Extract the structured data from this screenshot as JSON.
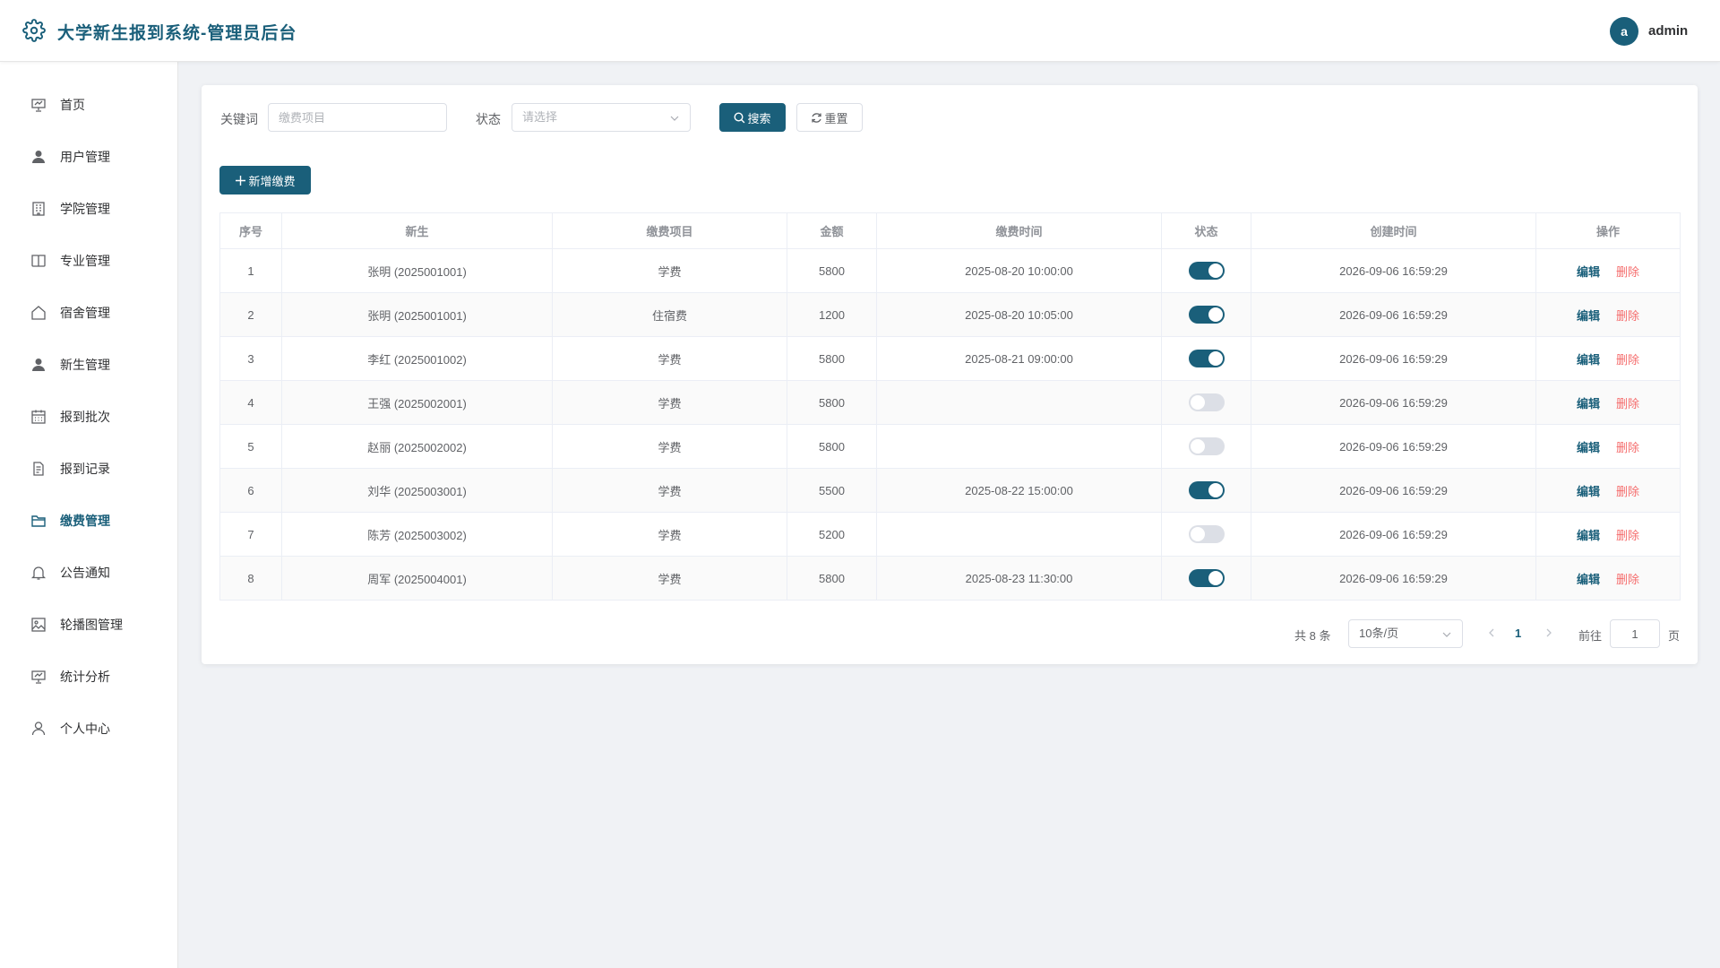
{
  "header": {
    "title": "大学新生报到系统-管理员后台",
    "avatar_letter": "a",
    "username": "admin"
  },
  "sidebar": {
    "items": [
      {
        "label": "首页",
        "icon": "presentation-icon"
      },
      {
        "label": "用户管理",
        "icon": "user-icon"
      },
      {
        "label": "学院管理",
        "icon": "building-icon"
      },
      {
        "label": "专业管理",
        "icon": "book-icon"
      },
      {
        "label": "宿舍管理",
        "icon": "home-icon"
      },
      {
        "label": "新生管理",
        "icon": "user-icon"
      },
      {
        "label": "报到批次",
        "icon": "calendar-icon"
      },
      {
        "label": "报到记录",
        "icon": "document-icon"
      },
      {
        "label": "缴费管理",
        "icon": "folder-icon",
        "active": true
      },
      {
        "label": "公告通知",
        "icon": "bell-icon"
      },
      {
        "label": "轮播图管理",
        "icon": "picture-icon"
      },
      {
        "label": "统计分析",
        "icon": "chart-icon"
      },
      {
        "label": "个人中心",
        "icon": "user-outline-icon"
      }
    ]
  },
  "filters": {
    "keyword_label": "关键词",
    "keyword_placeholder": "缴费项目",
    "status_label": "状态",
    "status_placeholder": "请选择",
    "search_label": "搜索",
    "reset_label": "重置"
  },
  "toolbar": {
    "add_label": "新增缴费"
  },
  "table": {
    "columns": [
      "序号",
      "新生",
      "缴费项目",
      "金额",
      "缴费时间",
      "状态",
      "创建时间",
      "操作"
    ],
    "edit_label": "编辑",
    "delete_label": "删除",
    "rows": [
      {
        "index": "1",
        "student": "张明 (2025001001)",
        "item": "学费",
        "amount": "5800",
        "pay_time": "2025-08-20 10:00:00",
        "paid": true,
        "created": "2026-09-06 16:59:29"
      },
      {
        "index": "2",
        "student": "张明 (2025001001)",
        "item": "住宿费",
        "amount": "1200",
        "pay_time": "2025-08-20 10:05:00",
        "paid": true,
        "created": "2026-09-06 16:59:29"
      },
      {
        "index": "3",
        "student": "李红 (2025001002)",
        "item": "学费",
        "amount": "5800",
        "pay_time": "2025-08-21 09:00:00",
        "paid": true,
        "created": "2026-09-06 16:59:29"
      },
      {
        "index": "4",
        "student": "王强 (2025002001)",
        "item": "学费",
        "amount": "5800",
        "pay_time": "",
        "paid": false,
        "created": "2026-09-06 16:59:29"
      },
      {
        "index": "5",
        "student": "赵丽 (2025002002)",
        "item": "学费",
        "amount": "5800",
        "pay_time": "",
        "paid": false,
        "created": "2026-09-06 16:59:29"
      },
      {
        "index": "6",
        "student": "刘华 (2025003001)",
        "item": "学费",
        "amount": "5500",
        "pay_time": "2025-08-22 15:00:00",
        "paid": true,
        "created": "2026-09-06 16:59:29"
      },
      {
        "index": "7",
        "student": "陈芳 (2025003002)",
        "item": "学费",
        "amount": "5200",
        "pay_time": "",
        "paid": false,
        "created": "2026-09-06 16:59:29"
      },
      {
        "index": "8",
        "student": "周军 (2025004001)",
        "item": "学费",
        "amount": "5800",
        "pay_time": "2025-08-23 11:30:00",
        "paid": true,
        "created": "2026-09-06 16:59:29"
      }
    ]
  },
  "pagination": {
    "total_text": "共 8 条",
    "page_size": "10条/页",
    "current_page": "1",
    "goto_label": "前往",
    "goto_value": "1",
    "page_unit": "页"
  },
  "colors": {
    "primary": "#1a5f7a",
    "danger": "#f56c6c",
    "background": "#f0f2f5"
  }
}
